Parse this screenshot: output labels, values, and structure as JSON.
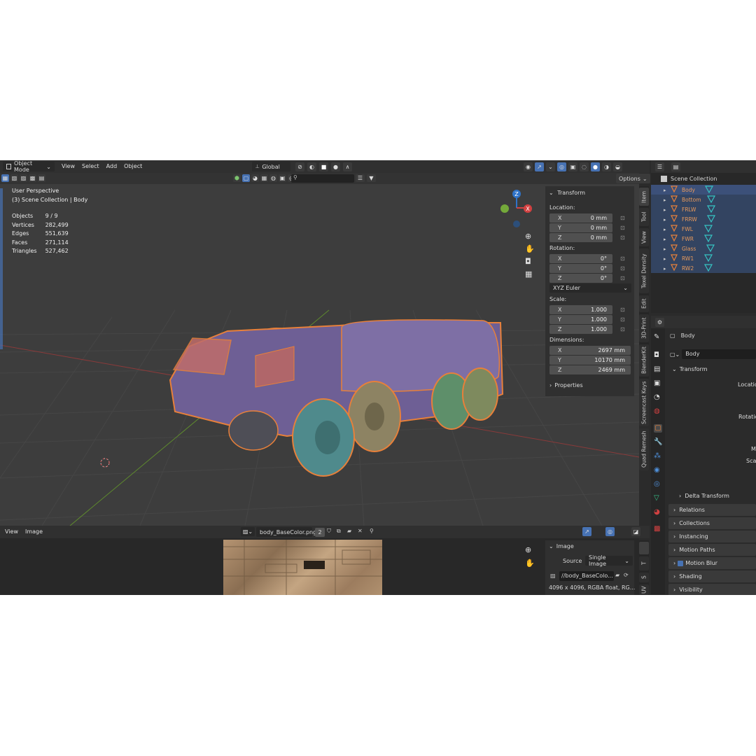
{
  "topbar": {
    "mode": "Object Mode",
    "menus": [
      "View",
      "Select",
      "Add",
      "Object"
    ],
    "orientation": "Global",
    "options": "Options"
  },
  "overlay": {
    "perspective": "User Perspective",
    "collection": "(3) Scene Collection | Body"
  },
  "stats": [
    {
      "label": "Objects",
      "value": "9 / 9"
    },
    {
      "label": "Vertices",
      "value": "282,499"
    },
    {
      "label": "Edges",
      "value": "551,639"
    },
    {
      "label": "Faces",
      "value": "271,114"
    },
    {
      "label": "Triangles",
      "value": "527,462"
    }
  ],
  "gizmo": {
    "z": "Z",
    "y": "Y",
    "x": "X"
  },
  "npanel": {
    "transform": "Transform",
    "location_label": "Location:",
    "location": [
      {
        "axis": "X",
        "value": "0 mm"
      },
      {
        "axis": "Y",
        "value": "0 mm"
      },
      {
        "axis": "Z",
        "value": "0 mm"
      }
    ],
    "rotation_label": "Rotation:",
    "rotation": [
      {
        "axis": "X",
        "value": "0°"
      },
      {
        "axis": "Y",
        "value": "0°"
      },
      {
        "axis": "Z",
        "value": "0°"
      }
    ],
    "rotation_mode": "XYZ Euler",
    "scale_label": "Scale:",
    "scale": [
      {
        "axis": "X",
        "value": "1.000"
      },
      {
        "axis": "Y",
        "value": "1.000"
      },
      {
        "axis": "Z",
        "value": "1.000"
      }
    ],
    "dimensions_label": "Dimensions:",
    "dimensions": [
      {
        "axis": "X",
        "value": "2697 mm"
      },
      {
        "axis": "Y",
        "value": "10170 mm"
      },
      {
        "axis": "Z",
        "value": "2469 mm"
      }
    ],
    "properties": "Properties"
  },
  "vtabs": [
    "Item",
    "Tool",
    "View",
    "Texel Density",
    "Edit",
    "3D-Print",
    "BlenderKit",
    "Screencast Keys",
    "Quad Remesh"
  ],
  "outliner": {
    "root": "Scene Collection",
    "items": [
      "Body",
      "Bottom",
      "FRLW",
      "FRRW",
      "FWL",
      "FWR",
      "Glass",
      "RW1",
      "RW2"
    ]
  },
  "properties": {
    "object_name": "Body",
    "data_name": "Body",
    "transform": "Transform",
    "loc": "Locatio",
    "rot": "Rotatio",
    "m": "M",
    "sca": "Sca",
    "delta": "Delta Transform",
    "sections": [
      "Relations",
      "Collections",
      "Instancing",
      "Motion Paths",
      "Motion Blur",
      "Shading",
      "Visibility"
    ]
  },
  "image_editor": {
    "menus": [
      "View",
      "Image"
    ],
    "image_name": "body_BaseColor.png",
    "users": "2",
    "panel_title": "Image",
    "source_label": "Source",
    "source": "Single Image",
    "filepath": "//body_BaseColo...",
    "info": "4096 x 4096,  RGBA float,  RG...",
    "tabs": [
      "T",
      "S",
      "UV"
    ]
  }
}
